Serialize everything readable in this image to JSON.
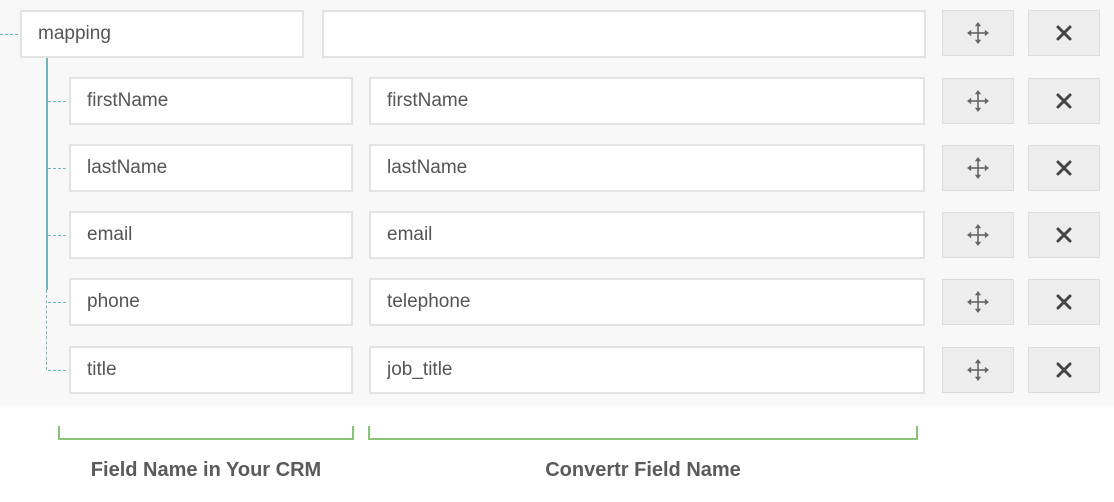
{
  "parent": {
    "key": "mapping",
    "value": ""
  },
  "rows": [
    {
      "key": "firstName",
      "value": "firstName"
    },
    {
      "key": "lastName",
      "value": "lastName"
    },
    {
      "key": "email",
      "value": "email"
    },
    {
      "key": "phone",
      "value": "telephone"
    },
    {
      "key": "title",
      "value": "job_title"
    }
  ],
  "icons": {
    "move": "move-icon",
    "delete": "close-icon"
  },
  "labels": {
    "crm_field": "Field Name in Your CRM",
    "convertr_field": "Convertr Field Name"
  },
  "colors": {
    "tree_line": "#6fb5bd",
    "bracket": "#8cc37a",
    "panel_bg": "#f8f8f8"
  }
}
